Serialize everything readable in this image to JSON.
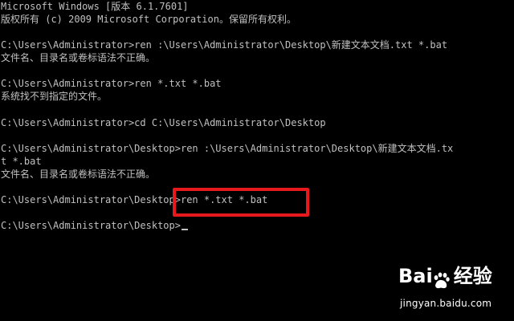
{
  "console": {
    "lines": [
      "Microsoft Windows [版本 6.1.7601]",
      "版权所有 (c) 2009 Microsoft Corporation。保留所有权利。",
      "",
      "C:\\Users\\Administrator>ren :\\Users\\Administrator\\Desktop\\新建文本文档.txt *.bat",
      "文件名、目录名或卷标语法不正确。",
      "",
      "C:\\Users\\Administrator>ren *.txt *.bat",
      "系统找不到指定的文件。",
      "",
      "C:\\Users\\Administrator>cd C:\\Users\\Administrator\\Desktop",
      "",
      "C:\\Users\\Administrator\\Desktop>ren :\\Users\\Administrator\\Desktop\\新建文本文档.tx",
      "t *.bat",
      "文件名、目录名或卷标语法不正确。",
      "",
      "C:\\Users\\Administrator\\Desktop>ren *.txt *.bat",
      "",
      "C:\\Users\\Administrator\\Desktop>"
    ]
  },
  "watermark": {
    "brand_left": "Bai",
    "brand_right": "经验",
    "site": "jingyan.baidu.com"
  },
  "colors": {
    "background": "#000000",
    "text": "#c0c0c0",
    "highlight": "#e8191c"
  }
}
